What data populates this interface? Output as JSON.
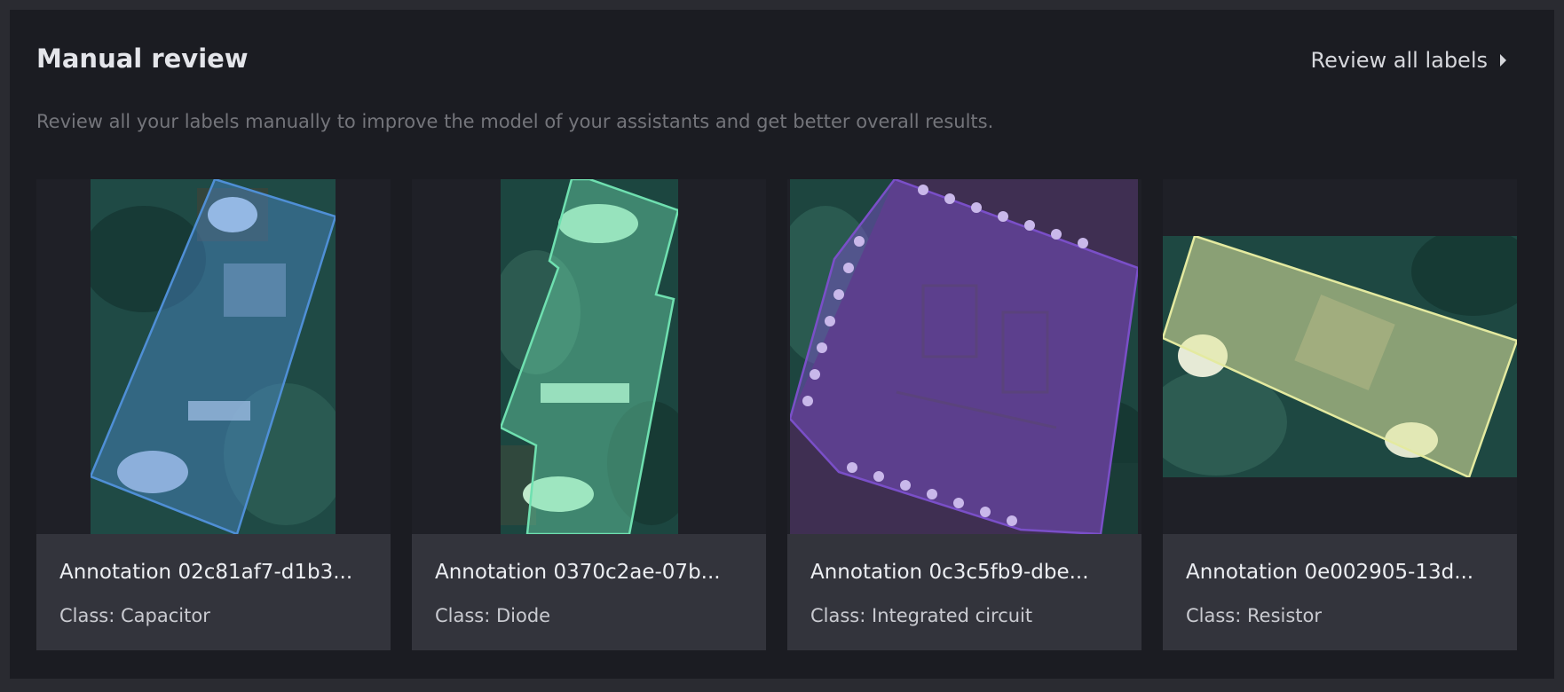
{
  "section": {
    "title": "Manual review",
    "subtitle": "Review all your labels manually to improve the model of your assistants and get better overall results.",
    "review_link_label": "Review all labels",
    "review_link_icon": "chevron-right-icon"
  },
  "cards": [
    {
      "name": "Annotation 02c81af7-d1b3...",
      "class_text": "Class: Capacitor",
      "label_color": "#4f8fd6"
    },
    {
      "name": "Annotation 0370c2ae-07b...",
      "class_text": "Class: Diode",
      "label_color": "#6fe0b0"
    },
    {
      "name": "Annotation 0c3c5fb9-dbe...",
      "class_text": "Class: Integrated circuit",
      "label_color": "#7a4fc8"
    },
    {
      "name": "Annotation 0e002905-13d...",
      "class_text": "Class: Resistor",
      "label_color": "#e4eaa0"
    }
  ]
}
